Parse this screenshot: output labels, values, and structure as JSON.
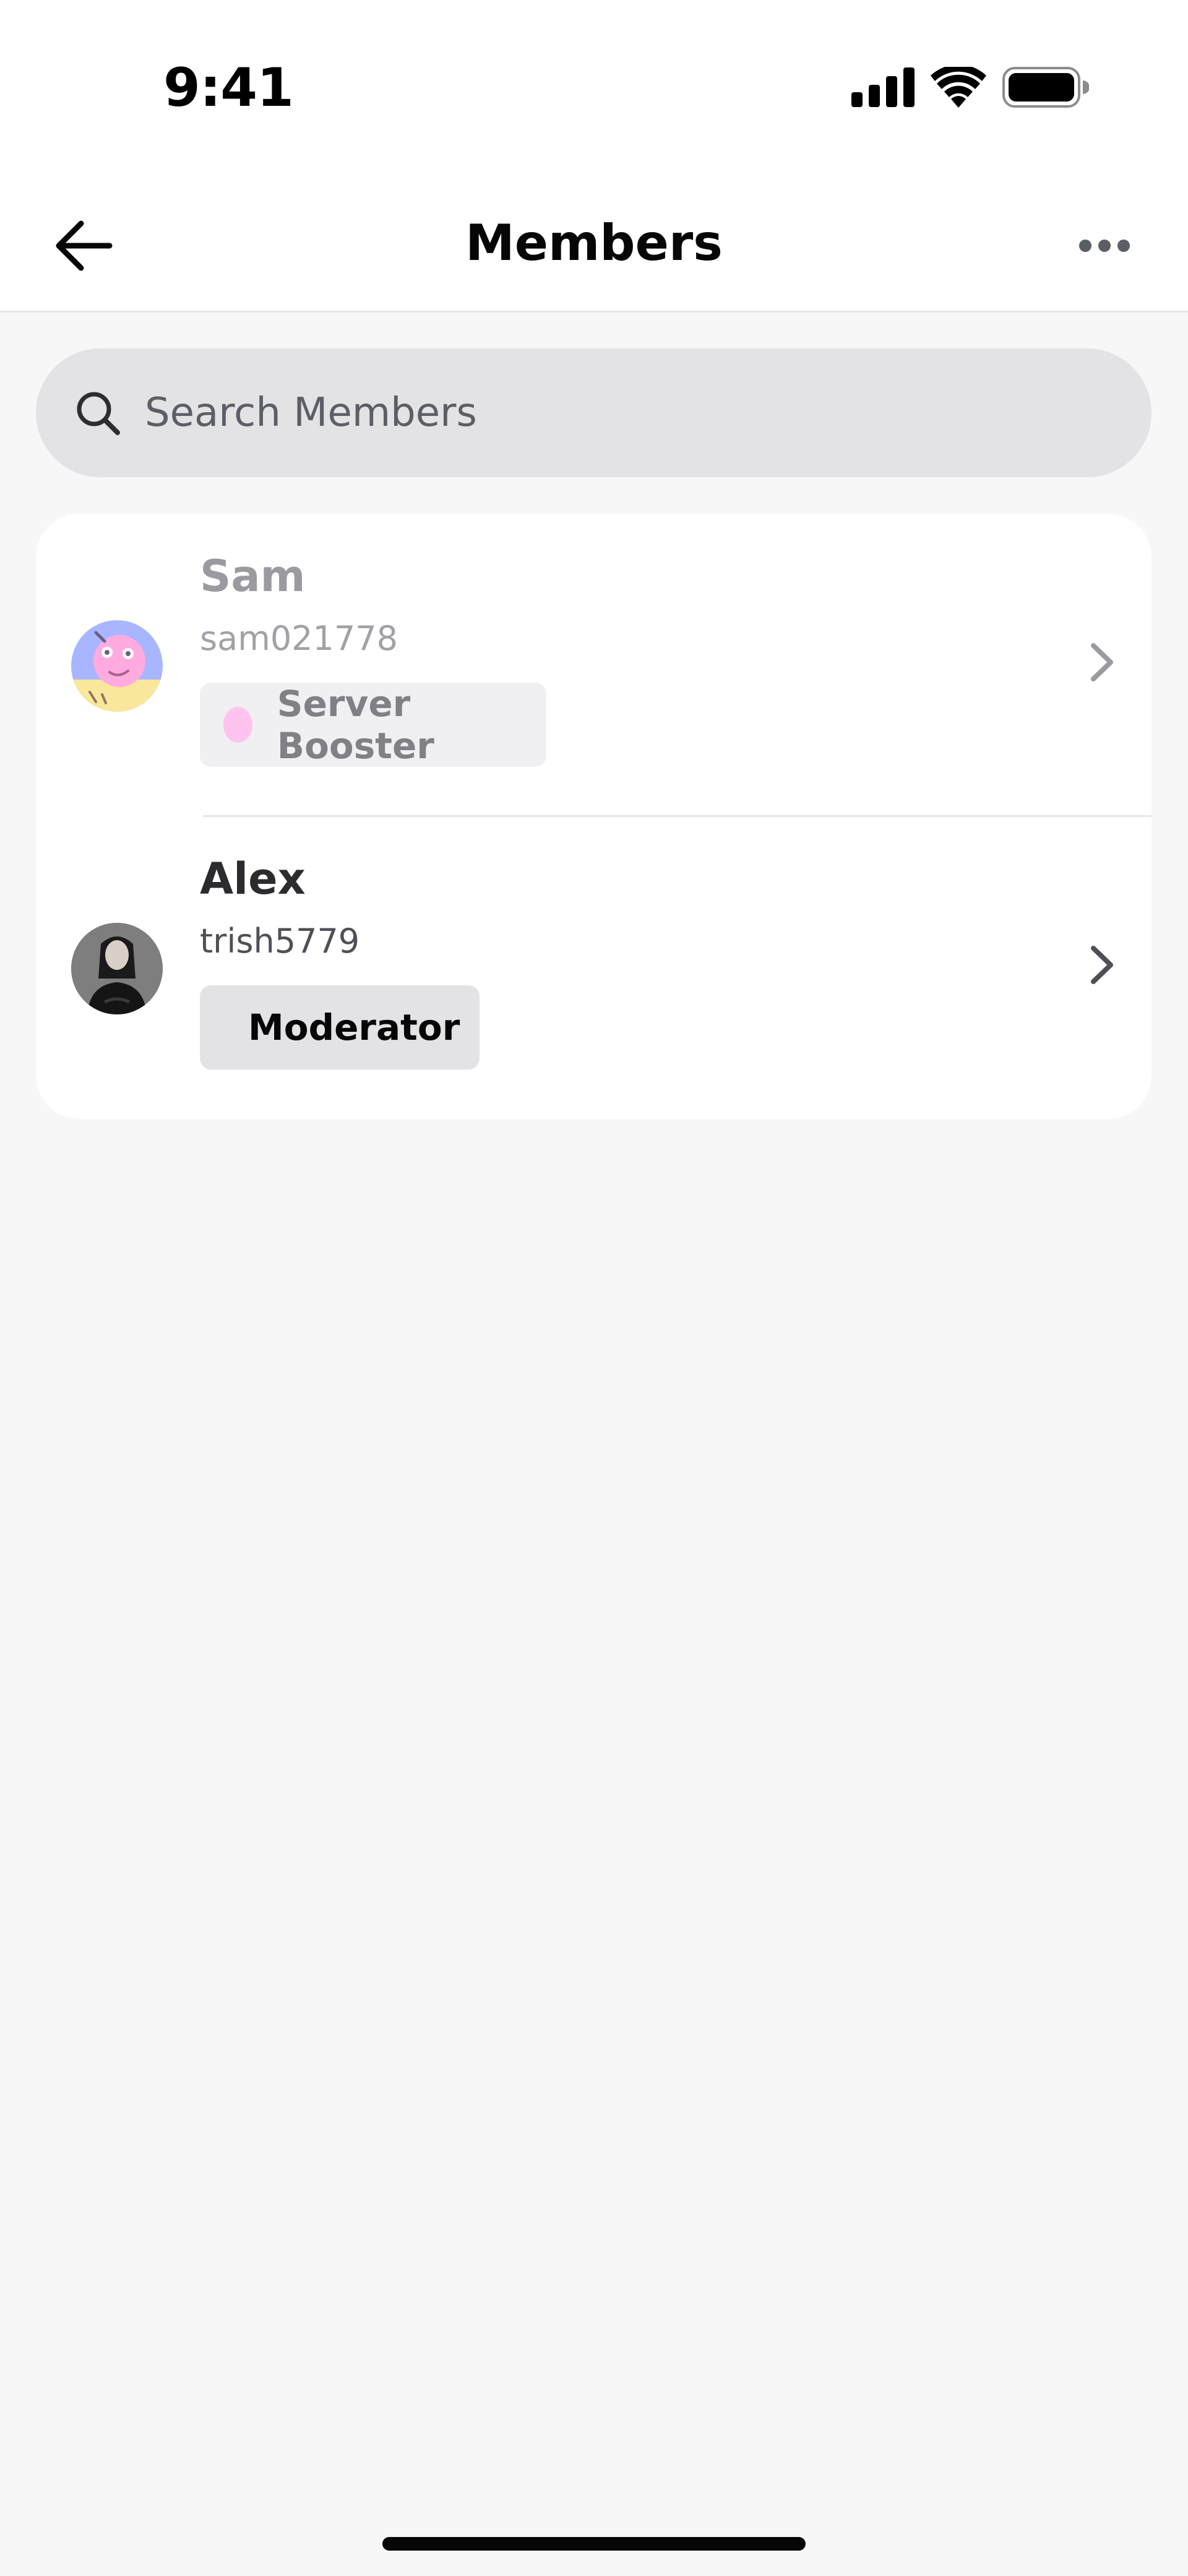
{
  "status_bar": {
    "time": "9:41",
    "icons": [
      "cellular-signal-icon",
      "wifi-icon",
      "battery-icon"
    ]
  },
  "header": {
    "title": "Members",
    "back_icon": "arrow-left-icon",
    "more_icon": "more-horizontal-icon"
  },
  "search": {
    "placeholder": "Search Members",
    "value": ""
  },
  "members": [
    {
      "name": "Sam",
      "username": "sam021778",
      "role": {
        "label": "Server Booster",
        "color": "#ffb8ec"
      },
      "avatar": "cartoon-avatar",
      "dimmed": true
    },
    {
      "name": "Alex",
      "username": "trish5779",
      "role": {
        "label": "Moderator",
        "color": "#9b59b6"
      },
      "avatar": "photo-avatar",
      "dimmed": false
    }
  ],
  "colors": {
    "background": "#f7f7f8",
    "card": "#ffffff",
    "search_bg": "#e3e3e5"
  }
}
